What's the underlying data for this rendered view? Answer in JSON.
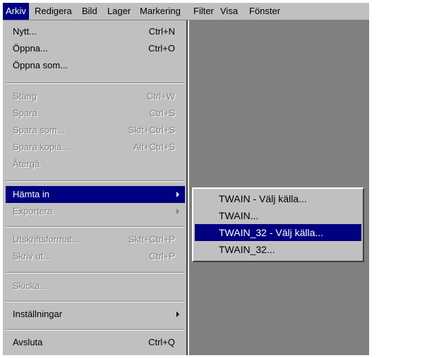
{
  "menubar": {
    "items": [
      {
        "label": "Arkiv"
      },
      {
        "label": "Redigera"
      },
      {
        "label": "Bild"
      },
      {
        "label": "Lager"
      },
      {
        "label": "Markering"
      },
      {
        "label": "Filter"
      },
      {
        "label": "Visa"
      },
      {
        "label": "Fönster"
      }
    ]
  },
  "file_menu": {
    "items": [
      {
        "label": "Nytt...",
        "shortcut": "Ctrl+N"
      },
      {
        "label": "Öppna...",
        "shortcut": "Ctrl+O"
      },
      {
        "label": "Öppna som..."
      },
      {
        "label": "Stäng",
        "shortcut": "Ctrl+W"
      },
      {
        "label": "Spara",
        "shortcut": "Ctrl+S"
      },
      {
        "label": "Spara som...",
        "shortcut": "Skft+Ctrl+S"
      },
      {
        "label": "Spara kopia...",
        "shortcut": "Alt+Ctrl+S"
      },
      {
        "label": "Återgå"
      },
      {
        "label": "Hämta in"
      },
      {
        "label": "Exportera"
      },
      {
        "label": "Utskriftsformat...",
        "shortcut": "Skft+Ctrl+P"
      },
      {
        "label": "Skriv ut...",
        "shortcut": "Ctrl+P"
      },
      {
        "label": "Skicka..."
      },
      {
        "label": "Inställningar"
      },
      {
        "label": "Avsluta",
        "shortcut": "Ctrl+Q"
      }
    ]
  },
  "import_submenu": {
    "items": [
      {
        "label": "TWAIN - Välj källa..."
      },
      {
        "label": "TWAIN..."
      },
      {
        "label": "TWAIN_32 - Välj källa..."
      },
      {
        "label": "TWAIN_32..."
      }
    ]
  },
  "colors": {
    "menu_face": "#c0c0c0",
    "highlight": "#000080",
    "workspace": "#808080",
    "disabled_text": "#808080"
  }
}
